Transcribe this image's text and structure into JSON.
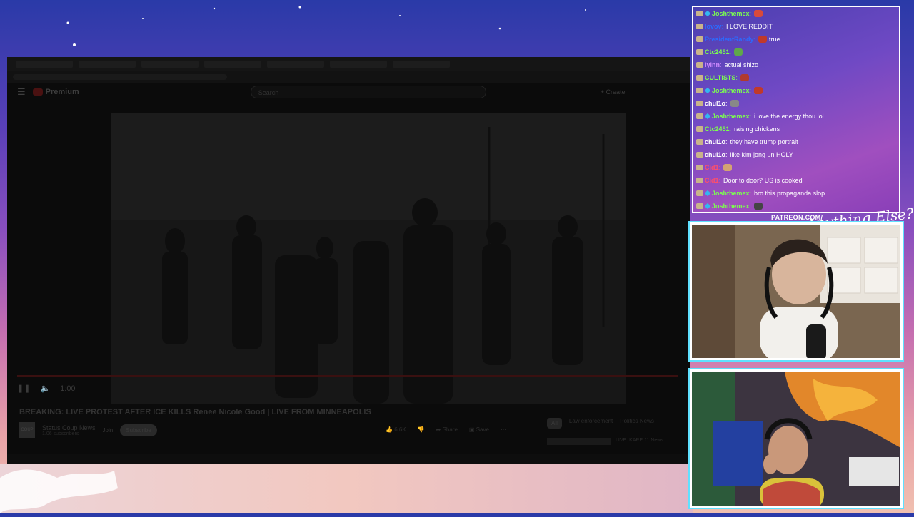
{
  "browser": {
    "youtube": {
      "logo": "Premium",
      "search_placeholder": "Search",
      "create_label": "Create"
    },
    "video": {
      "title": "BREAKING: LIVE PROTEST AFTER ICE KILLS Renee Nicole Good | LIVE FROM MINNEAPOLIS",
      "time": "1:00",
      "channel_name": "Status Coup News",
      "channel_subs": "1.06 subscribers",
      "channel_avatar_text": "COUP",
      "join_label": "Join",
      "subscribe_label": "Subscribe",
      "like_count": "6.6K",
      "share_label": "Share",
      "save_label": "Save"
    },
    "chips": [
      "All",
      "Law enforcement",
      "Politics News"
    ],
    "recommended": "LIVE: KARE 11 News..."
  },
  "chat": [
    {
      "user": "Joshthemex",
      "user_color": "#7CFF4F",
      "sub": true,
      "emote": "#d84a3a",
      "text": ""
    },
    {
      "user": "lovov",
      "user_color": "#2b6bff",
      "sub": false,
      "emote": null,
      "text": "I LOVE REDDIT"
    },
    {
      "user": "PresidentRandy",
      "user_color": "#2b6bff",
      "sub": false,
      "emote": "#c0392b",
      "text": "true"
    },
    {
      "user": "Ctc2451",
      "user_color": "#7CFF4F",
      "sub": false,
      "emote": "#5fa84a",
      "text": ""
    },
    {
      "user": "lylnn",
      "user_color": "#d08aff",
      "sub": false,
      "emote": null,
      "text": "actual shizo"
    },
    {
      "user": "CULTISTS",
      "user_color": "#7CFF4F",
      "sub": false,
      "emote": "#b03a2e",
      "text": ""
    },
    {
      "user": "Joshthemex",
      "user_color": "#7CFF4F",
      "sub": true,
      "emote": "#c0392b",
      "text": ""
    },
    {
      "user": "chul1o",
      "user_color": "#ffffff",
      "sub": false,
      "emote": "#888888",
      "text": ""
    },
    {
      "user": "Joshthemex",
      "user_color": "#7CFF4F",
      "sub": true,
      "emote": null,
      "text": "i love the energy thou lol"
    },
    {
      "user": "Ctc2451",
      "user_color": "#7CFF4F",
      "sub": false,
      "emote": null,
      "text": "raising chickens"
    },
    {
      "user": "chul1o",
      "user_color": "#ffffff",
      "sub": false,
      "emote": null,
      "text": "they have trump portrait"
    },
    {
      "user": "chul1o",
      "user_color": "#ffffff",
      "sub": false,
      "emote": null,
      "text": "like kim jong un HOLY"
    },
    {
      "user": "Cid1",
      "user_color": "#ff4f6a",
      "sub": false,
      "emote": "#d4a373",
      "text": ""
    },
    {
      "user": "Cid1",
      "user_color": "#ff4f6a",
      "sub": false,
      "emote": null,
      "text": "Door to door? US is cooked"
    },
    {
      "user": "Joshthemex",
      "user_color": "#7CFF4F",
      "sub": true,
      "emote": null,
      "text": "bro this propaganda slop"
    },
    {
      "user": "Joshthemex",
      "user_color": "#7CFF4F",
      "sub": true,
      "emote": "#444444",
      "text": ""
    }
  ],
  "overlay": {
    "patreon": "PATREON.COM/",
    "signature": "Anything Else?"
  }
}
